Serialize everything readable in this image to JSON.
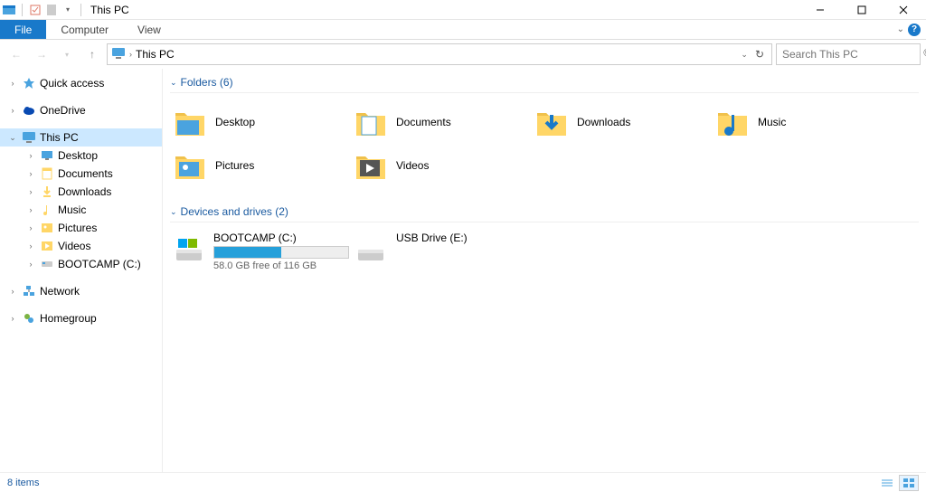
{
  "titlebar": {
    "app_title": "This PC"
  },
  "ribbon": {
    "tabs": [
      "File",
      "Computer",
      "View"
    ]
  },
  "address": {
    "crumb": "This PC",
    "search_placeholder": "Search This PC"
  },
  "sidebar": {
    "quick_access": "Quick access",
    "onedrive": "OneDrive",
    "this_pc": "This PC",
    "this_pc_children": [
      "Desktop",
      "Documents",
      "Downloads",
      "Music",
      "Pictures",
      "Videos",
      "BOOTCAMP (C:)"
    ],
    "network": "Network",
    "homegroup": "Homegroup"
  },
  "content": {
    "groups": {
      "folders_label": "Folders (6)",
      "drives_label": "Devices and drives (2)"
    },
    "folders": [
      "Desktop",
      "Documents",
      "Downloads",
      "Music",
      "Pictures",
      "Videos"
    ],
    "drives": [
      {
        "name": "BOOTCAMP (C:)",
        "free_text": "58.0 GB free of 116 GB",
        "fill_pct": 50,
        "has_bar": true
      },
      {
        "name": "USB Drive (E:)",
        "free_text": "",
        "fill_pct": 0,
        "has_bar": false
      }
    ]
  },
  "statusbar": {
    "count": "8 items"
  }
}
